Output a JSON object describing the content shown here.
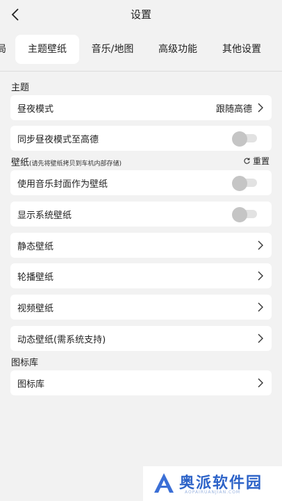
{
  "header": {
    "title": "设置",
    "back_icon": "chevron-left-icon"
  },
  "tabs": [
    {
      "label": "局",
      "active": false
    },
    {
      "label": "主题壁纸",
      "active": true
    },
    {
      "label": "音乐/地图",
      "active": false
    },
    {
      "label": "高级功能",
      "active": false
    },
    {
      "label": "其他设置",
      "active": false
    }
  ],
  "theme_section": {
    "label": "主题",
    "day_night": {
      "label": "昼夜模式",
      "value": "跟随高德"
    },
    "sync": {
      "label": "同步昼夜模式至高德",
      "enabled": false
    }
  },
  "wallpaper_section": {
    "label": "壁纸",
    "note": "(请先将壁纸拷贝到车机内部存储)",
    "reset_label": "重置",
    "music_cover": {
      "label": "使用音乐封面作为壁纸",
      "enabled": false
    },
    "system_wallpaper": {
      "label": "显示系统壁纸",
      "enabled": false
    },
    "static": {
      "label": "静态壁纸"
    },
    "carousel": {
      "label": "轮播壁纸"
    },
    "video": {
      "label": "视频壁纸"
    },
    "dynamic": {
      "label": "动态壁纸(需系统支持)"
    }
  },
  "icon_section": {
    "label": "图标库",
    "icon_library": {
      "label": "图标库"
    }
  },
  "watermark": {
    "text": "奥派软件园",
    "url": "AOPAIRUANJIAN.COM"
  },
  "colors": {
    "background": "#f2f2f2",
    "card": "#ffffff",
    "toggle_off": "#c5c5c5",
    "watermark": "#2d63c8"
  }
}
